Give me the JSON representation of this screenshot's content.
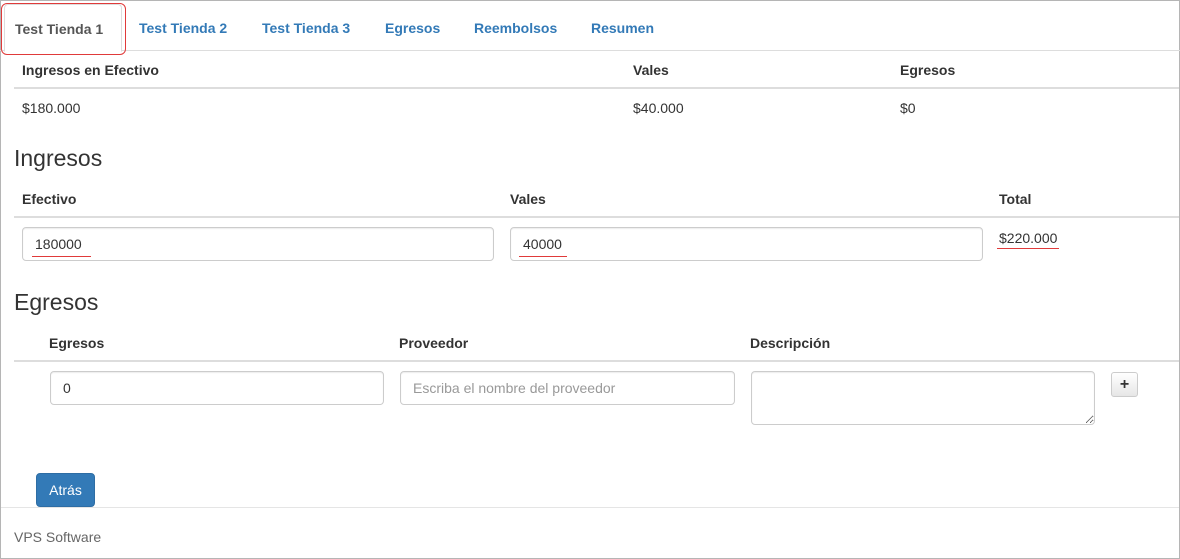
{
  "tabs": [
    {
      "label": "Test Tienda 1",
      "active": true
    },
    {
      "label": "Test Tienda 2"
    },
    {
      "label": "Test Tienda 3"
    },
    {
      "label": "Egresos"
    },
    {
      "label": "Reembolsos"
    },
    {
      "label": "Resumen"
    }
  ],
  "summary": {
    "headers": [
      "Ingresos en Efectivo",
      "Vales",
      "Egresos"
    ],
    "values": [
      "$180.000",
      "$40.000",
      "$0"
    ]
  },
  "ingresos": {
    "title": "Ingresos",
    "headers": [
      "Efectivo",
      "Vales",
      "Total"
    ],
    "efectivo_value": "180000",
    "vales_value": "40000",
    "total": "$220.000"
  },
  "egresos": {
    "title": "Egresos",
    "headers": [
      "Egresos",
      "Proveedor",
      "Descripción"
    ],
    "egresos_value": "0",
    "proveedor_placeholder": "Escriba el nombre del proveedor",
    "descripcion_value": ""
  },
  "buttons": {
    "plus": "+",
    "back": "Atrás"
  },
  "footer": "VPS Software",
  "colors": {
    "link": "#337ab7",
    "primary": "#337ab7",
    "highlight": "#e03a3a"
  }
}
